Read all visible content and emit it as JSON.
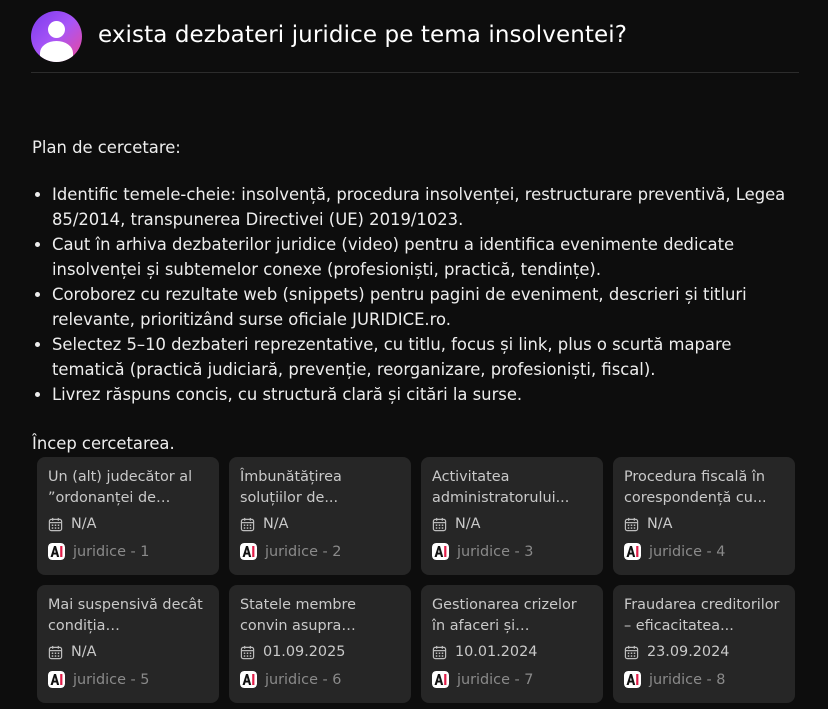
{
  "header": {
    "question": "exista dezbateri juridice pe tema insolventei?"
  },
  "content": {
    "plan_title": "Plan de cercetare:",
    "plan_items": [
      "Identific temele-cheie: insolvență, procedura insolvenței, restructurare preventivă, Legea 85/2014, transpunerea Directivei (UE) 2019/1023.",
      "Caut în arhiva dezbaterilor juridice (video) pentru a identifica evenimente dedicate insolvenței și subtemelor conexe (profesioniști, practică, tendințe).",
      "Coroborez cu rezultate web (snippets) pentru pagini de eveniment, descrieri și titluri relevante, prioritizând surse oficiale JURIDICE.ro.",
      "Selectez 5–10 dezbateri reprezentative, cu titlu, focus și link, plus o scurtă mapare tematică (practică judiciară, prevenție, reorganizare, profesioniști, fiscal).",
      "Livrez răspuns concis, cu structură clară și citări la surse."
    ],
    "start_text": "Încep cercetarea."
  },
  "cards": [
    {
      "title": "Un (alt) judecător al ”ordonanței de plată”...",
      "date": "N/A",
      "source": "juridice - 1"
    },
    {
      "title": "Îmbunătățirea soluțiilor de...",
      "date": "N/A",
      "source": "juridice - 2"
    },
    {
      "title": "Activitatea administratorului...",
      "date": "N/A",
      "source": "juridice - 3"
    },
    {
      "title": "Procedura fiscală în corespondență cu...",
      "date": "N/A",
      "source": "juridice - 4"
    },
    {
      "title": "Mai suspensivă decât condiția suspensivă:...",
      "date": "N/A",
      "source": "juridice - 5"
    },
    {
      "title": "Statele membre convin asupra poziție...",
      "date": "01.09.2025",
      "source": "juridice - 6"
    },
    {
      "title": "Gestionarea crizelor în afaceri și prevenirea...",
      "date": "10.01.2024",
      "source": "juridice - 7"
    },
    {
      "title": "Fraudarea creditorilor – eficacitatea...",
      "date": "23.09.2024",
      "source": "juridice - 8"
    }
  ],
  "icons": {
    "avatar": "user-avatar-icon",
    "calendar": "calendar-icon",
    "source_logo": "ai-logo-icon"
  },
  "colors": {
    "background": "#0d0d0d",
    "card": "#262626",
    "avatar_gradient_start": "#7c3aed",
    "avatar_gradient_end": "#ec4899"
  }
}
